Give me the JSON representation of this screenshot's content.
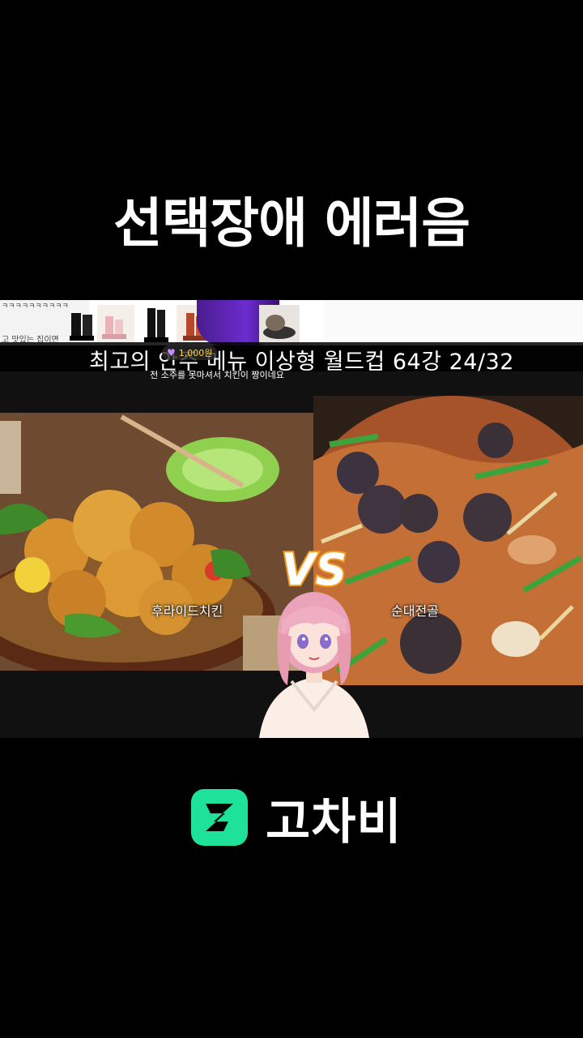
{
  "caption": {
    "title": "선택장애 에러음"
  },
  "stream": {
    "ad_ticker_top": "ㅋㅋㅋㅋㅋㅋㅋㅋㅋㅋ",
    "ad_ticker_bottom": "고 맛있는 집이면",
    "worldcup_title": "최고의 안주 메뉴 이상형 월드컵   64강   24/32",
    "donation": "1,000원",
    "chat_message": "전 소주를 못마셔서 치킨이 짱이네요",
    "left_food_label": "후라이드치킨",
    "right_food_label": "순대전골",
    "vs_label": "VS"
  },
  "brand": {
    "name": "고차비",
    "color": "#1fe29a"
  }
}
